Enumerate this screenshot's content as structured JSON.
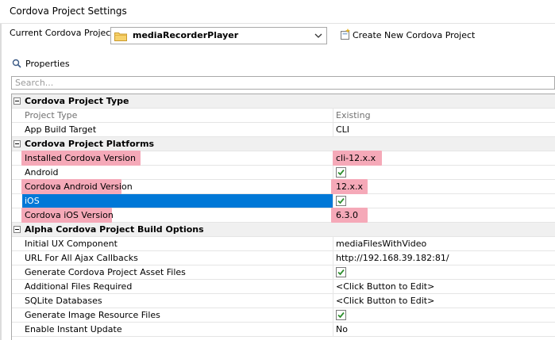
{
  "window": {
    "title": "Cordova Project Settings"
  },
  "project": {
    "label": "Current Cordova Project",
    "value": "mediaRecorderPlayer",
    "create_label": "Create New Cordova Project"
  },
  "properties_tab": {
    "label": "Properties"
  },
  "search": {
    "placeholder": "Search..."
  },
  "sections": [
    {
      "title": "Cordova Project Type",
      "rows": [
        {
          "name": "Project Type",
          "value": "Existing",
          "readonly": true
        },
        {
          "name": "App Build Target",
          "value": "CLI"
        }
      ]
    },
    {
      "title": "Cordova Project Platforms",
      "rows": [
        {
          "name": "Installed Cordova Version",
          "value": "cli-12.x.x",
          "highlight": true
        },
        {
          "name": "Android",
          "value": true,
          "type": "checkbox"
        },
        {
          "name": "Cordova Android Version",
          "value": "12.x.x",
          "highlight": true
        },
        {
          "name": "iOS",
          "value": true,
          "type": "checkbox",
          "selected": true
        },
        {
          "name": "Cordova iOS Version",
          "value": "6.3.0",
          "highlight": true
        }
      ]
    },
    {
      "title": "Alpha Cordova Project Build Options",
      "rows": [
        {
          "name": "Initial UX Component",
          "value": "mediaFilesWithVideo"
        },
        {
          "name": "URL For All Ajax Callbacks",
          "value": "http://192.168.39.182:81/"
        },
        {
          "name": "Generate Cordova Project Asset Files",
          "value": true,
          "type": "checkbox"
        },
        {
          "name": "Additional Files Required",
          "value": "<Click Button to Edit>"
        },
        {
          "name": "SQLite Databases",
          "value": "<Click Button to Edit>"
        },
        {
          "name": "Generate Image Resource Files",
          "value": true,
          "type": "checkbox"
        },
        {
          "name": "Enable Instant Update",
          "value": "No"
        }
      ]
    }
  ],
  "colors": {
    "highlight": "#f5a9b8",
    "selection": "#0078d7",
    "check": "#2f8f2f"
  }
}
